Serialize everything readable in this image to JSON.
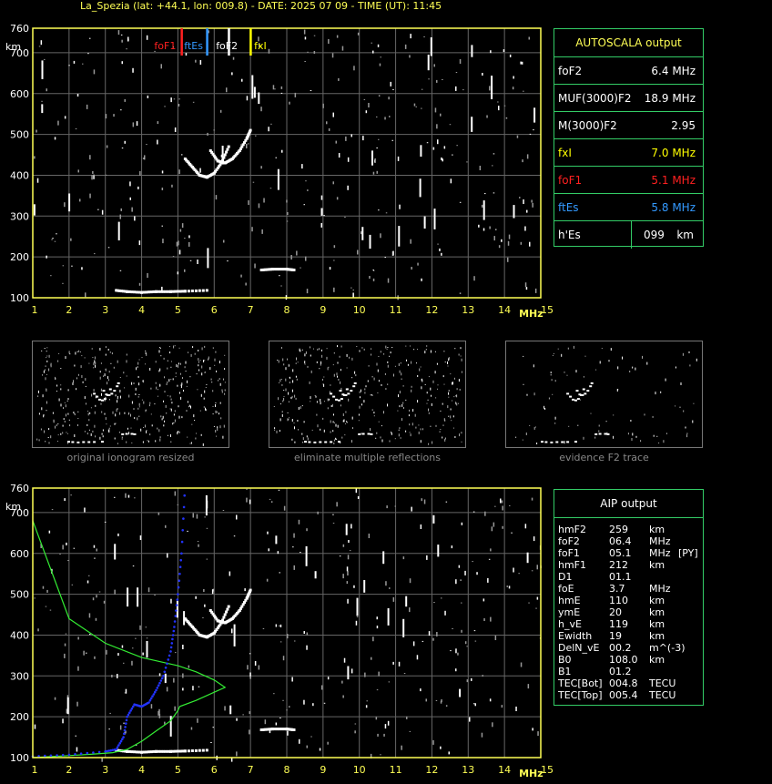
{
  "header": "La_Spezia (lat: +44.1, lon: 009.8) - DATE: 2025 07 09 - TIME (UT): 11:45",
  "colors": {
    "frame": "#ffff55",
    "grid": "#666666",
    "panel_border": "#33cc66",
    "foF1": "#ff2020",
    "ftEs": "#3399ff",
    "foF2": "#ffffff",
    "fxI": "#ffff00",
    "profile_green": "#33ee33",
    "profile_blue": "#2233ff"
  },
  "chart_data": [
    {
      "type": "scatter",
      "name": "ionogram",
      "title": "",
      "xlabel": "MHz",
      "ylabel": "km",
      "xlim": [
        1,
        15
      ],
      "ylim": [
        100,
        760
      ],
      "x_ticks": [
        "1",
        "2",
        "3",
        "4",
        "5",
        "6",
        "7",
        "8",
        "9",
        "10",
        "11",
        "12",
        "13",
        "14",
        "15"
      ],
      "y_ticks": [
        "100",
        "200",
        "300",
        "400",
        "500",
        "600",
        "700",
        "760"
      ],
      "grid": true,
      "markers": [
        {
          "label": "foF1",
          "freq": 5.1,
          "color": "#ff2020"
        },
        {
          "label": "ftEs",
          "freq": 5.8,
          "color": "#3399ff"
        },
        {
          "label": "foF2",
          "freq": 6.4,
          "color": "#ffffff"
        },
        {
          "label": "fxI",
          "freq": 7.0,
          "color": "#ffff00"
        }
      ],
      "traces": {
        "es_layer": [
          [
            3.3,
            118
          ],
          [
            3.6,
            115
          ],
          [
            4.0,
            113
          ],
          [
            4.4,
            115
          ],
          [
            4.8,
            115
          ],
          [
            5.2,
            116
          ],
          [
            5.8,
            118
          ]
        ],
        "f_upper": [
          [
            7.3,
            168
          ],
          [
            7.6,
            170
          ],
          [
            8.0,
            170
          ],
          [
            8.2,
            168
          ]
        ],
        "f2_o": [
          [
            5.2,
            440
          ],
          [
            5.4,
            420
          ],
          [
            5.6,
            400
          ],
          [
            5.8,
            395
          ],
          [
            6.0,
            405
          ],
          [
            6.2,
            430
          ],
          [
            6.4,
            470
          ]
        ],
        "f2_x": [
          [
            5.9,
            460
          ],
          [
            6.1,
            435
          ],
          [
            6.3,
            430
          ],
          [
            6.5,
            440
          ],
          [
            6.7,
            460
          ],
          [
            6.9,
            490
          ],
          [
            7.0,
            510
          ]
        ]
      }
    },
    {
      "type": "line",
      "name": "aip_profile",
      "title": "",
      "xlim": [
        1,
        15
      ],
      "ylim": [
        100,
        760
      ],
      "series": [
        {
          "name": "",
          "color": "#33ee33",
          "x": [
            1.0,
            1.4,
            2.0,
            2.6,
            3.2,
            3.6,
            4.0,
            4.4,
            4.8,
            5.0,
            5.05,
            5.5,
            6.0,
            6.3,
            6.0,
            5.5,
            5.0,
            4.0,
            3.0,
            2.0,
            1.0
          ],
          "y": [
            100,
            102,
            105,
            108,
            112,
            120,
            140,
            165,
            190,
            215,
            225,
            240,
            260,
            272,
            290,
            310,
            325,
            345,
            380,
            440,
            680
          ]
        },
        {
          "name": "",
          "color": "#2233ff",
          "x": [
            1.0,
            2.0,
            3.0,
            3.3,
            3.5,
            3.6,
            3.8,
            4.0,
            4.2,
            4.4,
            4.6,
            4.8,
            4.9,
            5.0,
            5.1,
            5.2
          ],
          "y": [
            103,
            107,
            115,
            120,
            150,
            200,
            230,
            225,
            235,
            265,
            300,
            360,
            420,
            500,
            600,
            770
          ]
        }
      ],
      "x_ticks": [
        "1",
        "2",
        "3",
        "4",
        "5",
        "6",
        "7",
        "8",
        "9",
        "10",
        "11",
        "12",
        "13",
        "14",
        "15"
      ],
      "y_ticks": [
        "100",
        "200",
        "300",
        "400",
        "500",
        "600",
        "700",
        "760"
      ],
      "xlabel": "MHz",
      "ylabel": "km"
    }
  ],
  "autoscala": {
    "title": "AUTOSCALA output",
    "rows": [
      {
        "label": "foF2",
        "value": "6.4 MHz",
        "color": "#ffffff"
      },
      {
        "label": "MUF(3000)F2",
        "value": "18.9 MHz",
        "color": "#ffffff"
      },
      {
        "label": "M(3000)F2",
        "value": "2.95",
        "color": "#ffffff"
      },
      {
        "label": "fxI",
        "value": "7.0 MHz",
        "color": "#ffff00"
      },
      {
        "label": "foF1",
        "value": "5.1 MHz",
        "color": "#ff2020"
      },
      {
        "label": "ftEs",
        "value": "5.8 MHz",
        "color": "#3399ff"
      },
      {
        "label": "h'Es",
        "value": "099",
        "unit": "km",
        "color": "#ffffff"
      }
    ]
  },
  "thumbnails": [
    {
      "caption": "original ionogram resized"
    },
    {
      "caption": "eliminate multiple reflections"
    },
    {
      "caption": "evidence F2 trace"
    }
  ],
  "aip": {
    "title": "AIP output",
    "rows": [
      {
        "name": "hmF2",
        "value": "259",
        "unit": "km",
        "note": ""
      },
      {
        "name": "foF2",
        "value": "06.4",
        "unit": "MHz",
        "note": ""
      },
      {
        "name": "foF1",
        "value": "05.1",
        "unit": "MHz",
        "note": "[PY]"
      },
      {
        "name": "hmF1",
        "value": "212",
        "unit": "km",
        "note": ""
      },
      {
        "name": "D1",
        "value": "01.1",
        "unit": "",
        "note": ""
      },
      {
        "name": "foE",
        "value": "3.7",
        "unit": "MHz",
        "note": ""
      },
      {
        "name": "hmE",
        "value": "110",
        "unit": "km",
        "note": ""
      },
      {
        "name": "ymE",
        "value": "20",
        "unit": "km",
        "note": ""
      },
      {
        "name": "h_vE",
        "value": "119",
        "unit": "km",
        "note": ""
      },
      {
        "name": "Ewidth",
        "value": "19",
        "unit": "km",
        "note": ""
      },
      {
        "name": "DelN_vE",
        "value": "00.2",
        "unit": "m^(-3)",
        "note": ""
      },
      {
        "name": "B0",
        "value": "108.0",
        "unit": "km",
        "note": ""
      },
      {
        "name": "B1",
        "value": "01.2",
        "unit": "",
        "note": ""
      },
      {
        "name": "TEC[Bot]",
        "value": "004.8",
        "unit": "TECU",
        "note": ""
      },
      {
        "name": "TEC[Top]",
        "value": "005.4",
        "unit": "TECU",
        "note": ""
      }
    ]
  }
}
